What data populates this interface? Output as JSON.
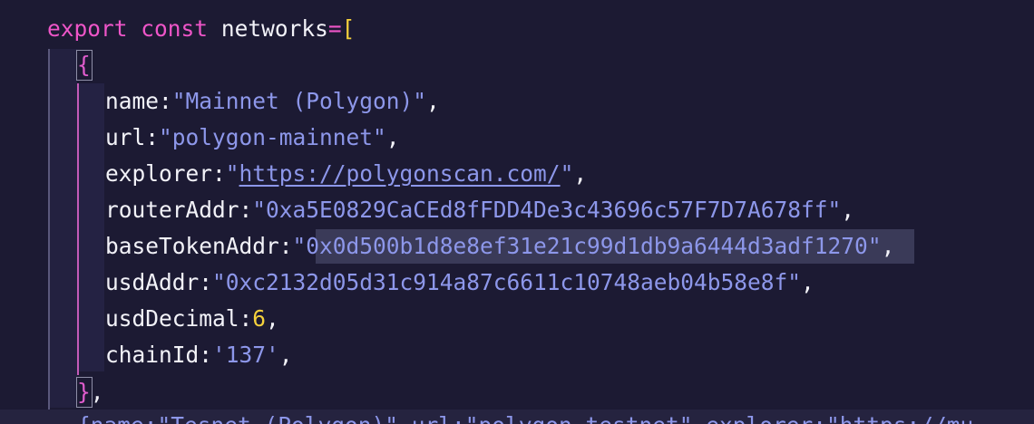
{
  "code": {
    "line1": {
      "keyword1": "export",
      "keyword2": "const",
      "ident": "networks",
      "op": "=",
      "bracket": "["
    },
    "line2": {
      "brace": "{"
    },
    "props": [
      {
        "key": "name",
        "colon": ":",
        "value": "\"Mainnet (Polygon)\"",
        "end": ","
      },
      {
        "key": "url",
        "colon": ":",
        "value": "\"polygon-mainnet\"",
        "end": ","
      },
      {
        "key": "explorer",
        "colon": ":",
        "quote_open": "\"",
        "link": "https://polygonscan.com/",
        "quote_close": "\"",
        "end": ","
      },
      {
        "key": "routerAddr",
        "colon": ":",
        "value": "\"0xa5E0829CaCEd8fFDD4De3c43696c57F7D7A678ff\"",
        "end": ","
      },
      {
        "key": "baseTokenAddr",
        "colon": ":",
        "quote_open": "\"",
        "selected": "0x0d500b1d8e8ef31e21c99d1db9a6444d3adf1270",
        "quote_close": "\"",
        "end": ","
      },
      {
        "key": "usdAddr",
        "colon": ":",
        "value": "\"0xc2132d05d31c914a87c6611c10748aeb04b58e8f\"",
        "end": ","
      },
      {
        "key": "usdDecimal",
        "colon": ":",
        "number": "6",
        "end": ","
      },
      {
        "key": "chainId",
        "colon": ":",
        "value": "'137'",
        "end": ","
      }
    ],
    "close": {
      "brace": "}",
      "end": ","
    },
    "next_line": "{name:\"Tesnet (Polygon)\",url:\"polygon-testnet\",explorer:\"https://mu"
  }
}
